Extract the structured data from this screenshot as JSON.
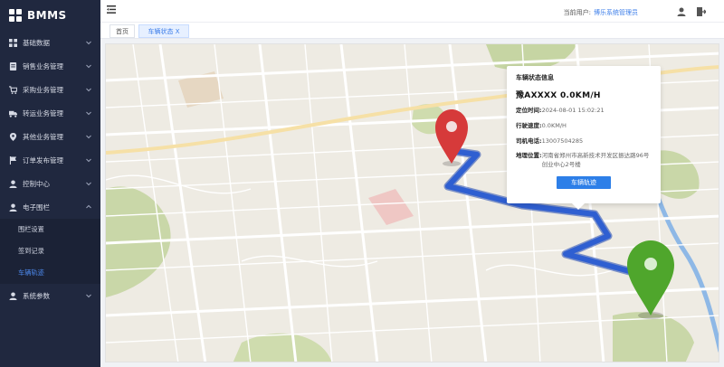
{
  "app": {
    "logo_text": "BMMS"
  },
  "sidebar": {
    "items": [
      {
        "label": "基础数据",
        "icon": "grid-icon"
      },
      {
        "label": "销售业务管理",
        "icon": "document-icon"
      },
      {
        "label": "采购业务管理",
        "icon": "cart-icon"
      },
      {
        "label": "转运业务管理",
        "icon": "truck-icon"
      },
      {
        "label": "其他业务管理",
        "icon": "location-icon"
      },
      {
        "label": "订单发布管理",
        "icon": "flag-icon"
      },
      {
        "label": "控制中心",
        "icon": "user-icon"
      },
      {
        "label": "电子围栏",
        "icon": "user-icon"
      }
    ],
    "subitems": [
      {
        "label": "围栏设置"
      },
      {
        "label": "签到记录"
      },
      {
        "label": "车辆轨迹"
      }
    ],
    "last_item": {
      "label": "系统参数",
      "icon": "user-icon"
    }
  },
  "header": {
    "current_user_label": "当前用户:",
    "current_user": "博乐系统管理员"
  },
  "tabs": [
    {
      "label": "首页"
    },
    {
      "label": "车辆状态 X"
    }
  ],
  "vehicle_info": {
    "title": "车辆状态信息",
    "plate_speed": "豫AXXXX 0.0KM/H",
    "location_time_label": "定位时间:",
    "location_time": "2024-08-01 15:02:21",
    "speed_label": "行驶速度:",
    "speed": "0.0KM/H",
    "driver_phone_label": "司机电话:",
    "driver_phone": "13007504285",
    "address_label": "地理位置:",
    "address": "河南省郑州市高新技术开发区振达路96号 创业中心2号楼",
    "track_button": "车辆轨迹"
  },
  "colors": {
    "sidebar_bg": "#20283f",
    "accent": "#2d7fe8",
    "route": "#2f5fd1",
    "start_pin": "#d63a3a",
    "end_pin": "#4fa62c"
  }
}
